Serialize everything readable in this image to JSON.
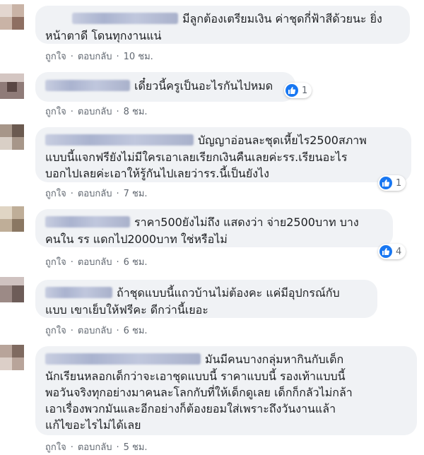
{
  "actions": {
    "like": "ถูกใจ",
    "reply": "ตอบกลับ",
    "separator": "·"
  },
  "comments": [
    {
      "lines": [
        "มีลูกต้องเตรียมเงิน ค่าชุดกี่ฟ้าสีด้วยนะ ยิ่ง",
        "หน้าตาดี โดนทุกงานแน่"
      ],
      "time": "10 ชม.",
      "reactions": null
    },
    {
      "lines": [
        "เดี๋ยวนี้ครูเป็นอะไรกันไปหมด"
      ],
      "time": "8 ชม.",
      "reactions": "1"
    },
    {
      "lines": [
        "บัญญาอ่อนละชุดเหี้ยไร2500สภาพ",
        "แบบนี้แจกฟรียังไม่มีใครเอาเลยเรียกเงินคืนเลยค่ะรร.เรียนอะไร",
        "บอกไปเลยค่ะเอาให้รู้กันไปเลยว่ารร.นี้เป็นยังไง"
      ],
      "time": "7 ชม.",
      "reactions": "1"
    },
    {
      "lines": [
        "ราคา500ยังไม่ถึง แสดงว่า จ่าย2500บาท บาง",
        "คนใน รร แดกไป2000บาท ใช่หรือไม่"
      ],
      "time": "6 ชม.",
      "reactions": "4"
    },
    {
      "lines": [
        "ถ้าชุดแบบนี้แถวบ้านไม่ต้องคะ แค่มีอุปกรณ์กับ",
        "แบบ เขาเย็บให้ฟรีคะ ดีกว่านี้เยอะ"
      ],
      "time": "6 ชม.",
      "reactions": null
    },
    {
      "lines": [
        "มันมีคนบางกลุ่มหากินกับเด็ก",
        "นักเรียนหลอกเด็กว่าจะเอาชุดแบบนี้ ราคาแบบนี้ รองเท้าแบบนี้",
        "พอวันจริงทุกอย่างมาคนละโลกกับที่ให้เด็กดูเลย เด็กก็กลัวไม่กล้า",
        "เอาเรื่องพวกมันและอีกอย่างก็ต้องยอมใส่เพราะถึงวันงานแล้า",
        "แก้ไขอะไรไม่ได้เลย"
      ],
      "time": "5 ชม.",
      "reactions": null
    }
  ],
  "colors": {
    "bubble": "#f0f2f5",
    "like_blue": "#1877f2",
    "meta_text": "#606770"
  },
  "icons": {
    "like": "thumbs-up-icon"
  }
}
